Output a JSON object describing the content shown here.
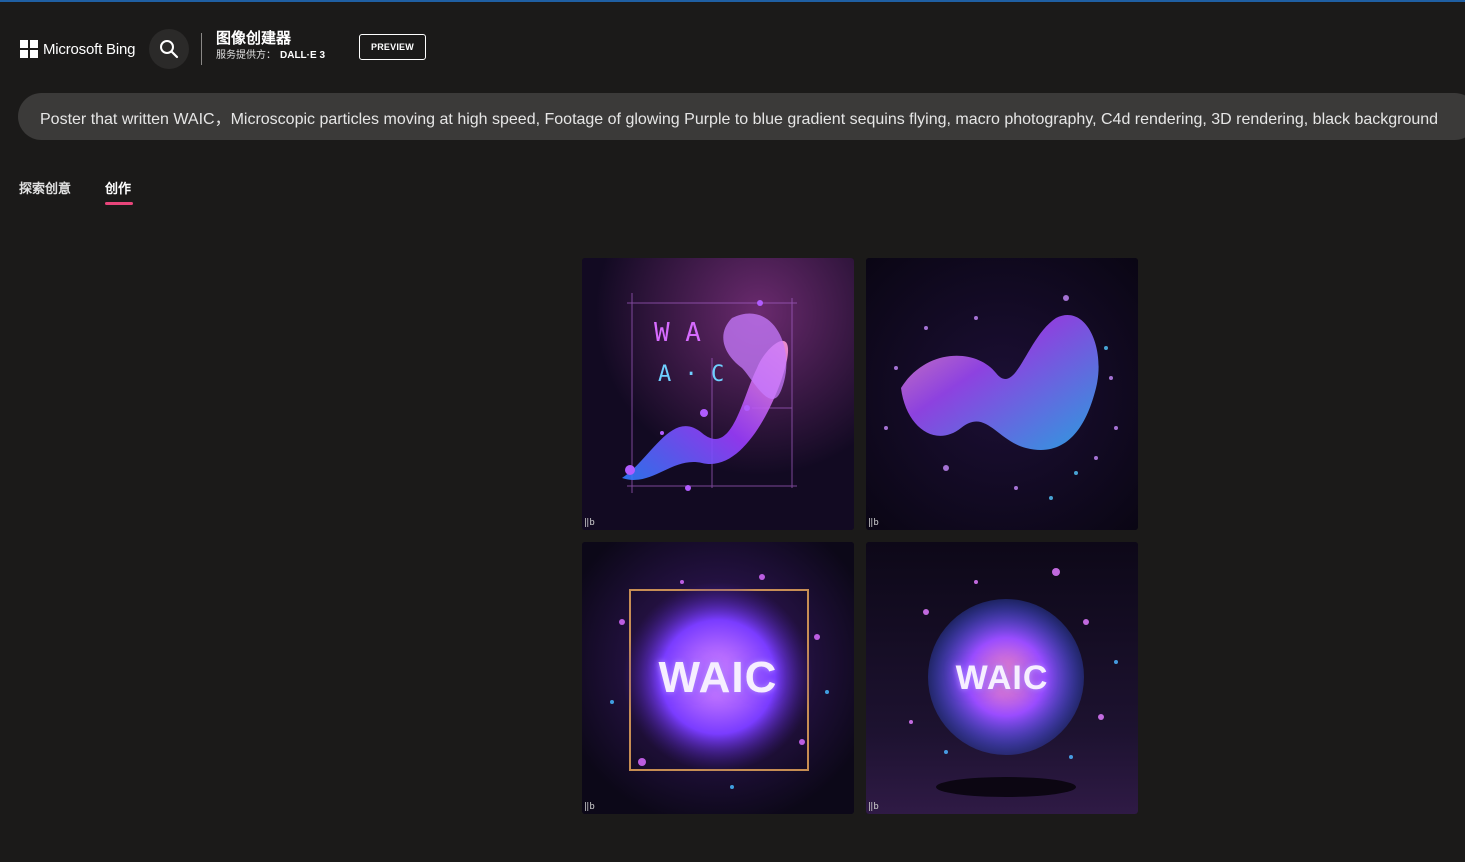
{
  "header": {
    "logo_text": "Microsoft Bing",
    "app_title": "图像创建器",
    "provider_label": "服务提供方：",
    "provider_name": "DALL·E 3",
    "preview_badge": "PREVIEW"
  },
  "prompt": {
    "text": "Poster that written WAIC，Microscopic particles moving at high speed, Footage of glowing Purple to blue gradient sequins flying, macro photography, C4d rendering, 3D rendering, black background"
  },
  "tabs": [
    {
      "label": "探索创意",
      "active": false
    },
    {
      "label": "创作",
      "active": true
    }
  ],
  "images": [
    {
      "text_line1": "W A",
      "text_line2": "A · C"
    },
    {
      "text": ""
    },
    {
      "text": "WAIC"
    },
    {
      "text": "WAIC"
    }
  ],
  "watermark": "b",
  "colors": {
    "accent_underline": "#e8457a",
    "top_line": "#1f5fa3",
    "background": "#1b1a19",
    "prompt_bg": "#3b3a39"
  },
  "icons": {
    "search": "search-icon",
    "logo": "microsoft-logo-icon"
  }
}
